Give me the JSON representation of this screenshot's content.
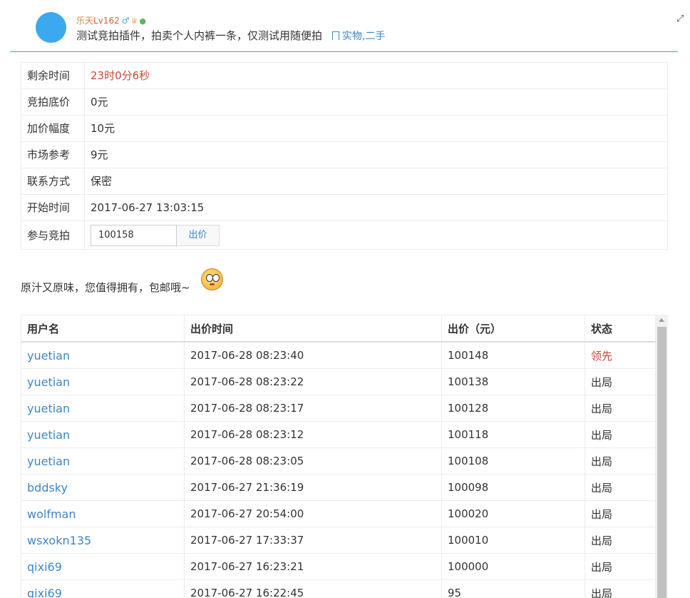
{
  "post": {
    "username": "乐天",
    "level": "Lv162",
    "gender_icon": "♂",
    "title": "测试竞拍插件，拍卖个人内裤一条，仅测试用随便拍",
    "tags": "实物,二手"
  },
  "auction": {
    "rows": [
      {
        "label": "剩余时间",
        "value": "23时0分6秒"
      },
      {
        "label": "竞拍底价",
        "value": "0元"
      },
      {
        "label": "加价幅度",
        "value": "10元"
      },
      {
        "label": "市场参考",
        "value": "9元"
      },
      {
        "label": "联系方式",
        "value": "保密"
      },
      {
        "label": "开始时间",
        "value": "2017-06-27 13:03:15"
      }
    ],
    "bid_label": "参与竞拍",
    "bid_input_value": "100158",
    "bid_button": "出价"
  },
  "description": "原汁又原味，您值得拥有，包邮哦~",
  "bids": {
    "headers": [
      "用户名",
      "出价时间",
      "出价（元）",
      "状态"
    ],
    "rows": [
      {
        "user": "yuetian",
        "time": "2017-06-28 08:23:40",
        "price": "100148",
        "status": "领先"
      },
      {
        "user": "yuetian",
        "time": "2017-06-28 08:23:22",
        "price": "100138",
        "status": "出局"
      },
      {
        "user": "yuetian",
        "time": "2017-06-28 08:23:17",
        "price": "100128",
        "status": "出局"
      },
      {
        "user": "yuetian",
        "time": "2017-06-28 08:23:12",
        "price": "100118",
        "status": "出局"
      },
      {
        "user": "yuetian",
        "time": "2017-06-28 08:23:05",
        "price": "100108",
        "status": "出局"
      },
      {
        "user": "bddsky",
        "time": "2017-06-27 21:36:19",
        "price": "100098",
        "status": "出局"
      },
      {
        "user": "wolfman",
        "time": "2017-06-27 20:54:00",
        "price": "100020",
        "status": "出局"
      },
      {
        "user": "wsxokn135",
        "time": "2017-06-27 17:33:37",
        "price": "100010",
        "status": "出局"
      },
      {
        "user": "qixi69",
        "time": "2017-06-27 16:23:21",
        "price": "100000",
        "status": "出局"
      },
      {
        "user": "qixi69",
        "time": "2017-06-27 16:22:45",
        "price": "95",
        "status": "出局"
      }
    ]
  },
  "colors": {
    "accent": "#3d85c6",
    "leading": "#c9473a",
    "avatar": "#3aa9ef"
  }
}
